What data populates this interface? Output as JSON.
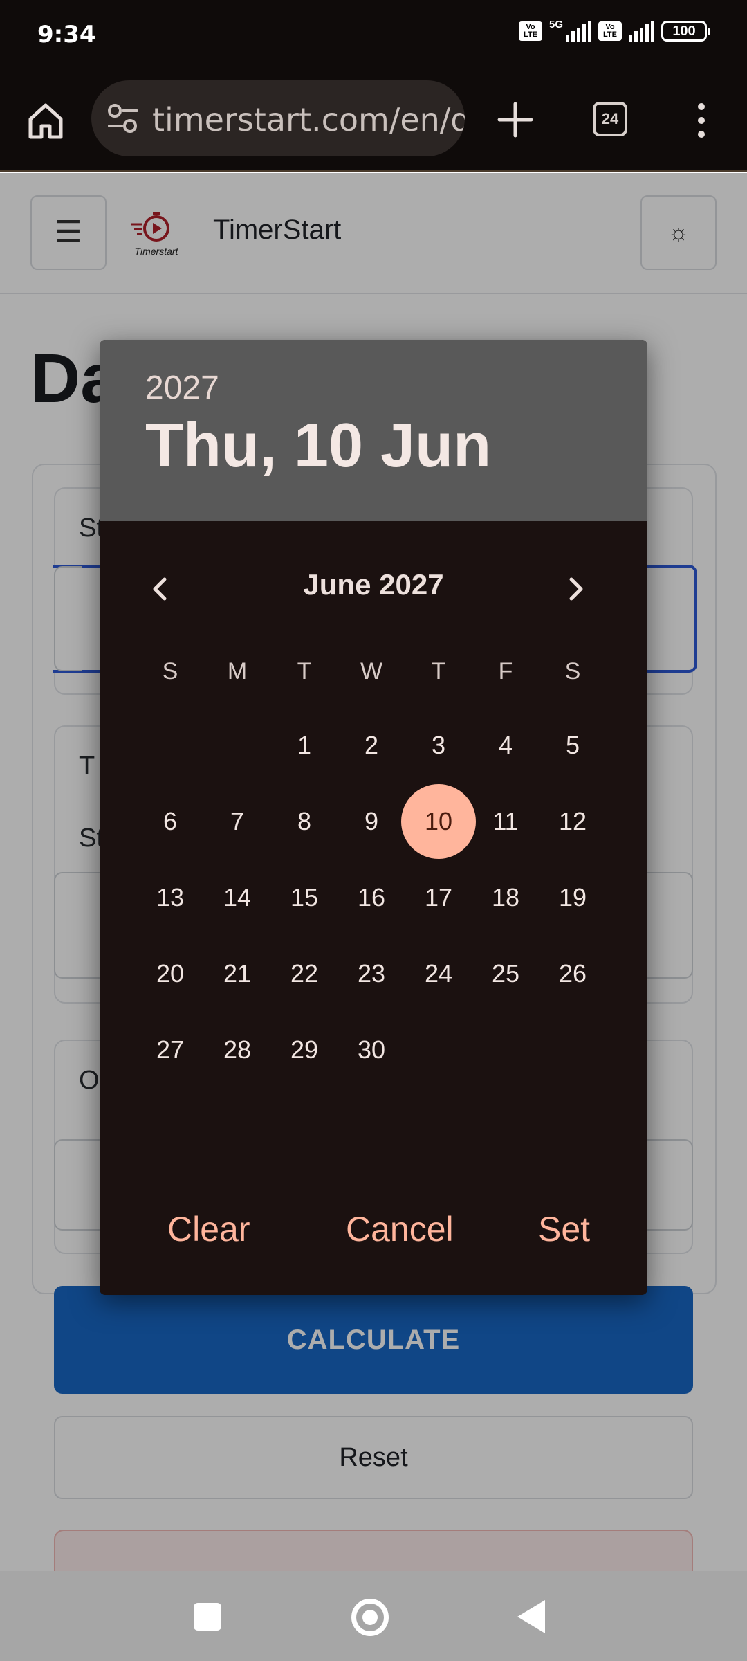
{
  "status_bar": {
    "time": "9:34",
    "network": "5G",
    "volte_label": "Vo LTE",
    "battery": "100"
  },
  "browser": {
    "url": "timerstart.com/en/d",
    "tab_count": "24"
  },
  "site": {
    "brand": "TimerStart",
    "logo_text": "Timerstart",
    "page_title": "Da",
    "calculate_label": "CALCULATE",
    "reset_label": "Reset"
  },
  "date_picker": {
    "year": "2027",
    "selected_date": "Thu, 10 Jun",
    "month_label": "June 2027",
    "weekdays": [
      "S",
      "M",
      "T",
      "W",
      "T",
      "F",
      "S"
    ],
    "first_weekday_index": 2,
    "days_in_month": 30,
    "selected_day": 10,
    "actions": {
      "clear": "Clear",
      "cancel": "Cancel",
      "set": "Set"
    }
  },
  "colors": {
    "accent": "#ffb59c",
    "dialog_bg": "#1b1110",
    "header_bg": "#595959",
    "primary_button": "#1967c6"
  },
  "icons": {
    "home": "home-icon",
    "site_settings": "tune-icon",
    "new_tab": "plus-icon",
    "menu": "more-vert-icon",
    "hamburger": "menu-icon",
    "theme": "sun-icon",
    "prev_month": "chevron-left-icon",
    "next_month": "chevron-right-icon"
  }
}
